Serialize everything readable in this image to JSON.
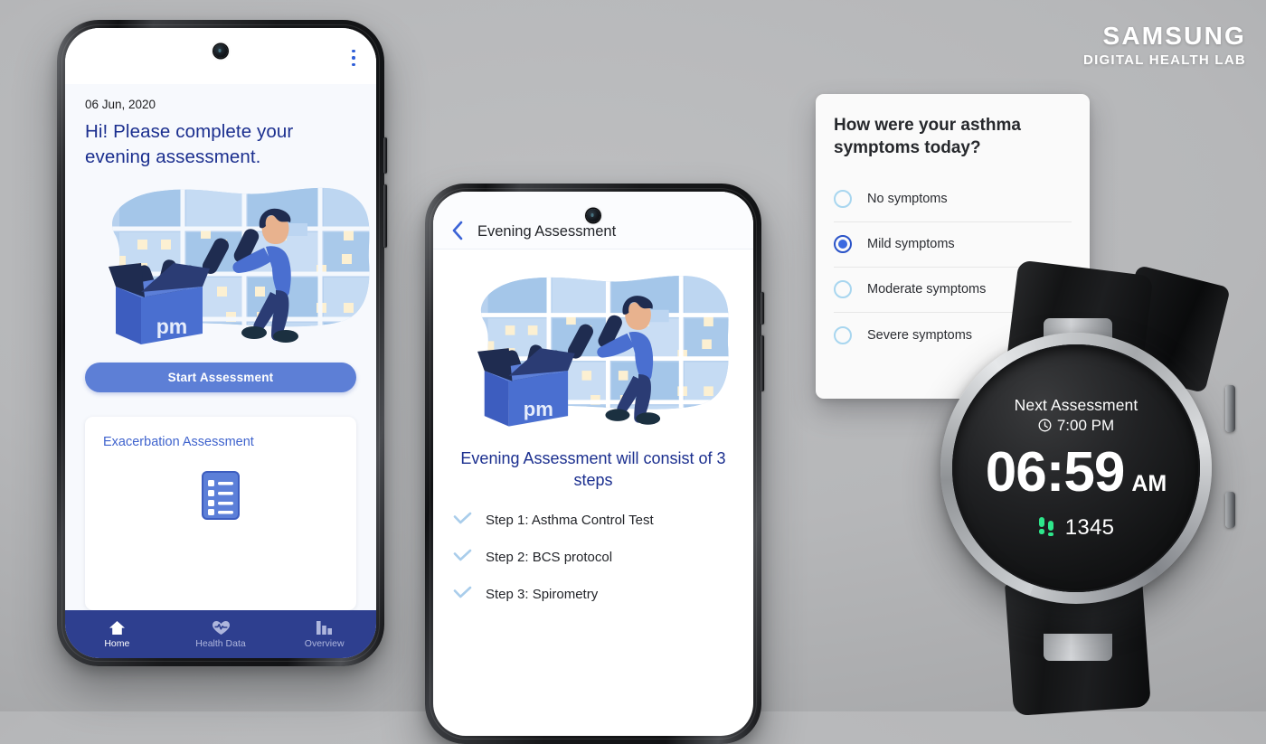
{
  "brand": {
    "name": "SAMSUNG",
    "tagline": "DIGITAL HEALTH LAB"
  },
  "colors": {
    "background": "#b6b7b9",
    "primary_navy": "#1b2f8f",
    "nav_bar": "#2e3f8f",
    "cta_blue": "#5d7fd6",
    "link_blue": "#3f63cd",
    "radio_selected": "#2a53c8",
    "radio_unselected": "#a8d6ef",
    "check_blue": "#a9cdeb",
    "watch_screen": "#121314",
    "steps_green": "#2ee68b"
  },
  "phone_home": {
    "menu_icon": "kebab-menu-icon",
    "camera_icon": "front-camera-icon",
    "date": "06 Jun, 2020",
    "greeting": "Hi! Please complete your evening assessment.",
    "illustration_label": "pm",
    "illustration_name": "evening-assessment-illustration",
    "start_button": "Start Assessment",
    "card": {
      "title": "Exacerbation Assessment",
      "icon": "checklist-form-icon"
    },
    "nav": [
      {
        "label": "Home",
        "icon": "home-icon",
        "active": true
      },
      {
        "label": "Health Data",
        "icon": "heart-pulse-icon",
        "active": false
      },
      {
        "label": "Overview",
        "icon": "bar-chart-icon",
        "active": false
      }
    ]
  },
  "phone_assessment": {
    "back_icon": "chevron-left-icon",
    "title": "Evening Assessment",
    "illustration_label": "pm",
    "illustration_name": "evening-assessment-illustration",
    "heading": "Evening Assessment will consist of 3 steps",
    "steps": [
      {
        "label": "Step 1: Asthma Control Test",
        "icon": "check-icon"
      },
      {
        "label": "Step 2: BCS protocol",
        "icon": "check-icon"
      },
      {
        "label": "Step 3: Spirometry",
        "icon": "check-icon"
      }
    ]
  },
  "survey": {
    "question": "How were your asthma symptoms today?",
    "options": [
      {
        "label": "No symptoms",
        "selected": false
      },
      {
        "label": "Mild symptoms",
        "selected": true
      },
      {
        "label": "Moderate symptoms",
        "selected": false
      },
      {
        "label": "Severe symptoms",
        "selected": false
      }
    ],
    "selected_value": "Mild symptoms"
  },
  "watch": {
    "next_assessment_label": "Next Assessment",
    "next_assessment_time": "7:00 PM",
    "clock_icon": "clock-icon",
    "current_time": "06:59",
    "meridiem": "AM",
    "steps_icon": "footsteps-icon",
    "steps_count": "1345"
  }
}
